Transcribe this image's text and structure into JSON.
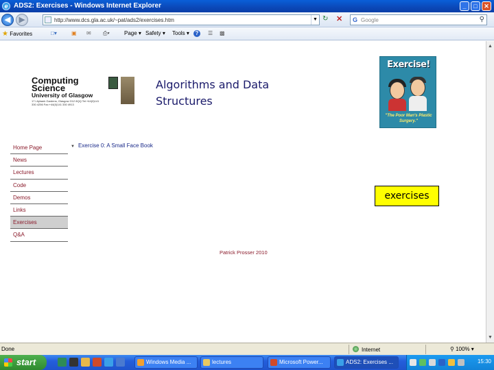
{
  "window": {
    "title": "ADS2: Exercises - Windows Internet Explorer",
    "controls": {
      "minimize": "_",
      "maximize": "□",
      "close": "✕"
    }
  },
  "address_bar": {
    "url": "http://www.dcs.gla.ac.uk/~pat/ads2/exercises.htm",
    "search_placeholder": "Google"
  },
  "command_bar": {
    "favorites": "Favorites",
    "page": "Page ▾",
    "safety": "Safety ▾",
    "tools": "Tools ▾",
    "help": "?"
  },
  "page": {
    "logo": {
      "line1": "Computing",
      "line2": "Science",
      "line3": "University of Glasgow",
      "address": "17 Lilybank Gardens, Glasgow G12 8QQ Tel:+44(0)141 330 4256 Fax:+44(0)141 330 4913"
    },
    "site_title_line1": "Algorithms and Data",
    "site_title_line2": "Structures",
    "poster": {
      "title": "Exercise!",
      "tagline": "\"The Poor Man's Plastic Surgery.\""
    },
    "nav": [
      {
        "label": "Home Page",
        "active": false
      },
      {
        "label": "News",
        "active": false
      },
      {
        "label": "Lectures",
        "active": false
      },
      {
        "label": "Code",
        "active": false
      },
      {
        "label": "Demos",
        "active": false
      },
      {
        "label": "Links",
        "active": false
      },
      {
        "label": "Exercises",
        "active": true
      },
      {
        "label": "Q&A",
        "active": false
      }
    ],
    "breadcrumb": "Exercise 0: A Small Face Book",
    "callout": "exercises",
    "footer": "Patrick Prosser 2010"
  },
  "status_bar": {
    "status": "Done",
    "zone": "Internet",
    "zoom": "100%"
  },
  "taskbar": {
    "start": "start",
    "tasks": [
      {
        "label": "Windows Media ...",
        "active": false
      },
      {
        "label": "lectures",
        "active": false
      },
      {
        "label": "Microsoft Power...",
        "active": false
      },
      {
        "label": "ADS2: Exercises ...",
        "active": true
      }
    ],
    "clock": "15:30"
  },
  "colors": {
    "nav_link": "#8a1a2a",
    "title_text": "#1a1a6a",
    "callout_bg": "#ffff00",
    "taskbar": "#245edb"
  }
}
